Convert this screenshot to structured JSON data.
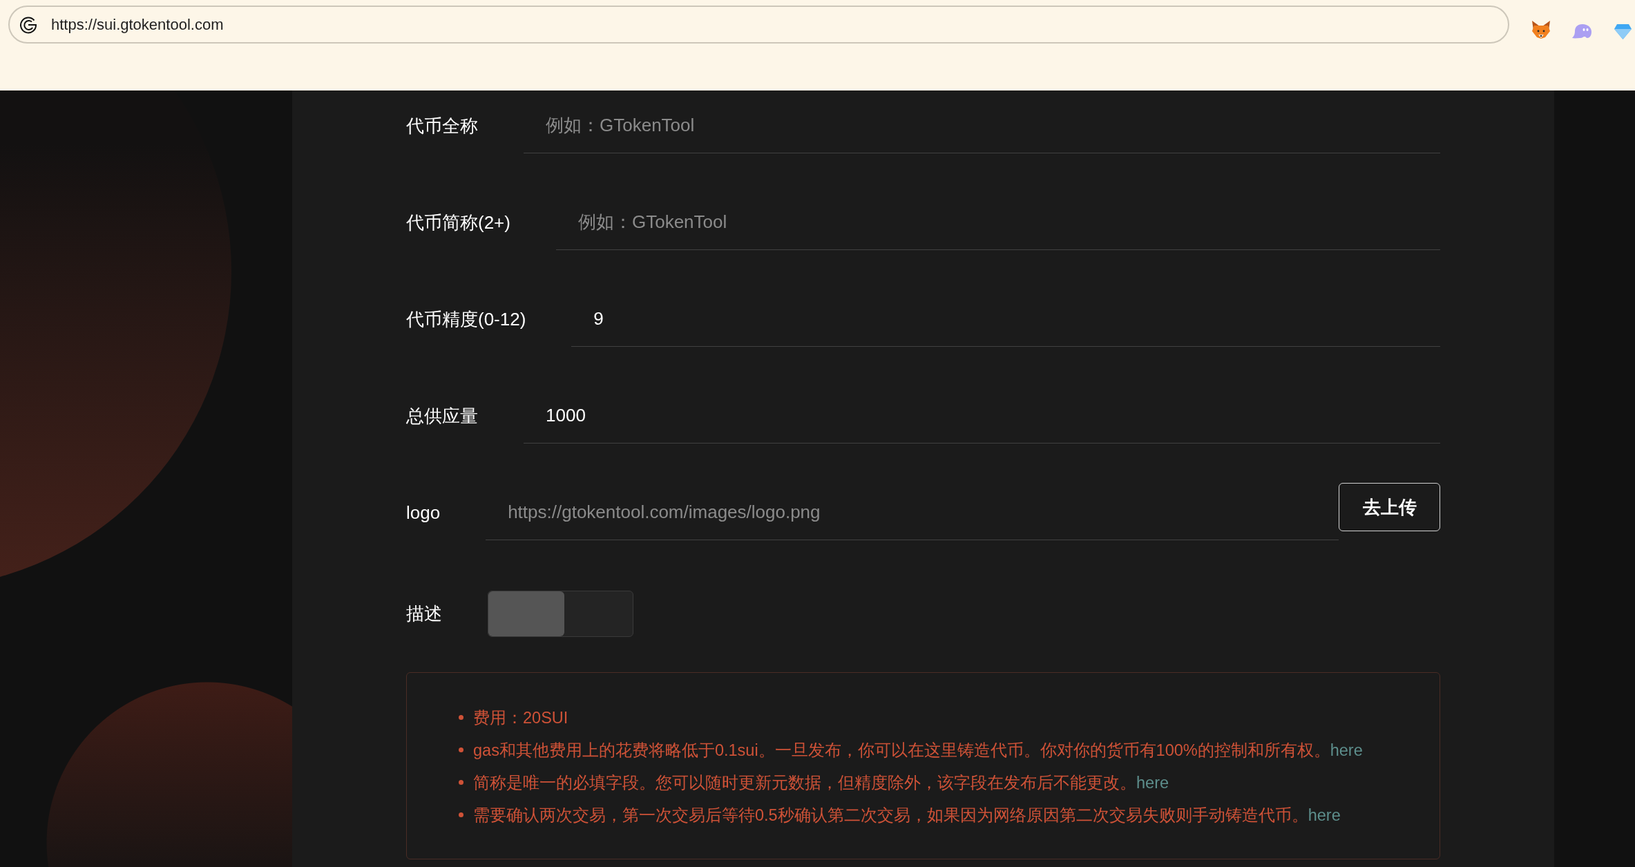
{
  "browser": {
    "url": "https://sui.gtokentool.com"
  },
  "form": {
    "fields": [
      {
        "kind": "text",
        "label": "代币全称",
        "placeholder": "例如：GTokenTool"
      },
      {
        "kind": "text",
        "label": "代币简称(2+)",
        "placeholder": "例如：GTokenTool"
      },
      {
        "kind": "text",
        "label": "代币精度(0-12)",
        "value": "9"
      },
      {
        "kind": "text",
        "label": "总供应量",
        "value": "1000"
      },
      {
        "kind": "upload",
        "label": "logo",
        "placeholder": "https://gtokentool.com/images/logo.png",
        "button": "去上传"
      },
      {
        "kind": "toggle",
        "label": "描述",
        "on": false
      }
    ]
  },
  "notes": {
    "items": [
      {
        "text": "费用：20SUI"
      },
      {
        "text": "gas和其他费用上的花费将略低于0.1sui。一旦发布，你可以在这里铸造代币。你对你的货币有100%的控制和所有权。",
        "link": "here"
      },
      {
        "text": "简称是唯一的必填字段。您可以随时更新元数据，但精度除外，该字段在发布后不能更改。",
        "link": "here"
      },
      {
        "text": "需要确认两次交易，第一次交易后等待0.5秒确认第二次交易，如果因为网络原因第二次交易失败则手动铸造代币。",
        "link": "here"
      }
    ]
  }
}
